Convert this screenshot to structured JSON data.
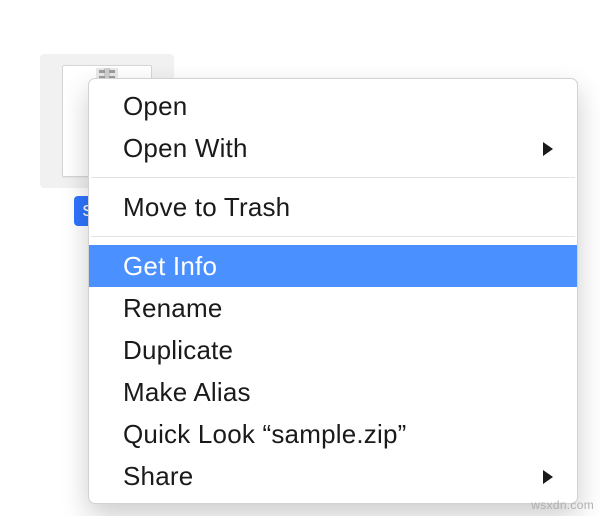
{
  "file": {
    "label": "samp",
    "icon": "zip-file-icon"
  },
  "contextMenu": {
    "items": [
      {
        "label": "Open",
        "hasSubmenu": false,
        "selected": false
      },
      {
        "label": "Open With",
        "hasSubmenu": true,
        "selected": false
      },
      {
        "label": "Move to Trash",
        "hasSubmenu": false,
        "selected": false
      },
      {
        "label": "Get Info",
        "hasSubmenu": false,
        "selected": true
      },
      {
        "label": "Rename",
        "hasSubmenu": false,
        "selected": false
      },
      {
        "label": "Duplicate",
        "hasSubmenu": false,
        "selected": false
      },
      {
        "label": "Make Alias",
        "hasSubmenu": false,
        "selected": false
      },
      {
        "label": "Quick Look “sample.zip”",
        "hasSubmenu": false,
        "selected": false
      },
      {
        "label": "Share",
        "hasSubmenu": true,
        "selected": false
      }
    ],
    "separatorsAfter": [
      1,
      2
    ]
  },
  "watermark": "wsxdn.com",
  "colors": {
    "highlight": "#4a90ff",
    "labelBg": "#2f74ff"
  }
}
